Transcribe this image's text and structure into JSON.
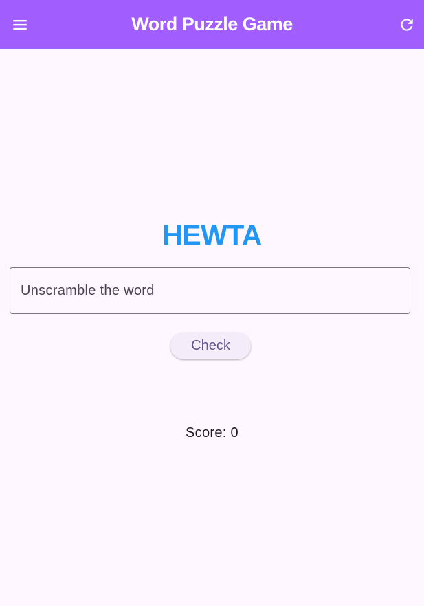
{
  "app_bar": {
    "title": "Word Puzzle Game",
    "leading_icon": "menu-icon",
    "trailing_icon": "refresh-icon",
    "background_color": "#A25DFE"
  },
  "game": {
    "scrambled_word": "HEWTA",
    "scrambled_color": "#2196F3",
    "input": {
      "value": "",
      "placeholder": "Unscramble the word"
    },
    "check_label": "Check",
    "score_label": "Score:",
    "score_value": "0"
  }
}
